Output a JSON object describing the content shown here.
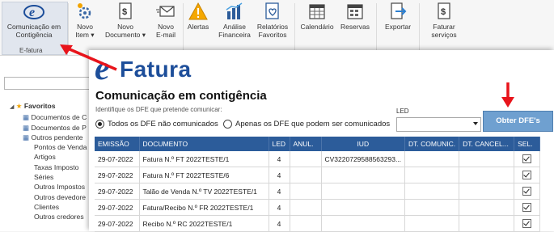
{
  "ribbon": {
    "buttons": [
      {
        "label1": "Comunicação em",
        "label2": "Contigência",
        "icon": "efatura-logo-icon"
      },
      {
        "label1": "Novo",
        "label2": "Item ▾",
        "icon": "gear-star-icon"
      },
      {
        "label1": "Novo",
        "label2": "Documento ▾",
        "icon": "document-euro-icon"
      },
      {
        "label1": "Novo",
        "label2": "E-mail",
        "icon": "envelope-icon"
      },
      {
        "label1": "Alertas",
        "label2": "",
        "icon": "warning-icon"
      },
      {
        "label1": "Análise",
        "label2": "Financeira",
        "icon": "bar-chart-icon"
      },
      {
        "label1": "Relatórios",
        "label2": "Favoritos",
        "icon": "favorite-report-icon"
      },
      {
        "label1": "Calendário",
        "label2": "",
        "icon": "calendar-icon"
      },
      {
        "label1": "Reservas",
        "label2": "",
        "icon": "reservations-calendar-icon"
      },
      {
        "label1": "Exportar",
        "label2": "",
        "icon": "export-icon"
      },
      {
        "label1": "Faturar",
        "label2": "serviços",
        "icon": "invoice-euro-icon"
      }
    ],
    "group_efatura": "E-fatura"
  },
  "sidebar": {
    "favorites_label": "Favoritos",
    "items": [
      "Documentos de C",
      "Documentos de P",
      "Outros pendente",
      "Pontos de Venda",
      "Artigos",
      "Taxas Imposto",
      "Séries",
      "Outros Impostos",
      "Outros devedore",
      "Clientes",
      "Outros credores"
    ]
  },
  "dialog": {
    "logo_e": "e",
    "logo_rest": "Fatura",
    "title": "Comunicação em contigência",
    "subtitle": "Identifique os DFE que pretende comunicar:",
    "radio_all": "Todos os DFE não comunicados",
    "radio_some": "Apenas os DFE que podem ser comunicados",
    "led_label": "LED",
    "led_value": "",
    "obter_button": "Obter DFE's"
  },
  "table": {
    "headers": [
      "EMISSÃO",
      "DOCUMENTO",
      "LED",
      "ANUL.",
      "IUD",
      "DT. COMUNIC.",
      "DT. CANCEL...",
      "SEL."
    ],
    "rows": [
      {
        "emissao": "29-07-2022",
        "documento": "Fatura N.º FT 2022TESTE/1",
        "led": "4",
        "anul": "",
        "iud": "CV3220729588563293...",
        "dt_comunic": "",
        "dt_cancel": ""
      },
      {
        "emissao": "29-07-2022",
        "documento": "Fatura N.º FT 2022TESTE/6",
        "led": "4",
        "anul": "",
        "iud": "",
        "dt_comunic": "",
        "dt_cancel": ""
      },
      {
        "emissao": "29-07-2022",
        "documento": "Talão de Venda N.º TV 2022TESTE/1",
        "led": "4",
        "anul": "",
        "iud": "",
        "dt_comunic": "",
        "dt_cancel": ""
      },
      {
        "emissao": "29-07-2022",
        "documento": "Fatura/Recibo N.º FR 2022TESTE/1",
        "led": "4",
        "anul": "",
        "iud": "",
        "dt_comunic": "",
        "dt_cancel": ""
      },
      {
        "emissao": "29-07-2022",
        "documento": "Recibo N.º RC 2022TESTE/1",
        "led": "4",
        "anul": "",
        "iud": "",
        "dt_comunic": "",
        "dt_cancel": ""
      }
    ]
  },
  "colors": {
    "accent": "#2c5c9a",
    "button": "#6fa0d0",
    "annotation_arrow": "#e8141b"
  }
}
